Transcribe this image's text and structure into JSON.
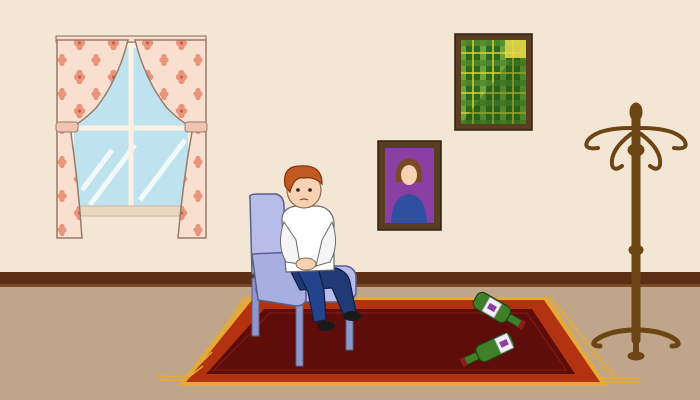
{
  "scene": {
    "type": "point-and-click room",
    "colors": {
      "wall": "#f3e6d4",
      "floor": "#bfa58a",
      "baseboard": "#5a2f14",
      "rug_outer": "#b3320f",
      "rug_inner": "#5e0d0a",
      "rug_fringe": "#e3a93a",
      "chair": "#b7bde8",
      "coat_rack": "#6b4513",
      "bottle_glass": "#3f7f27",
      "curtain": "#f8dfd0",
      "curtain_flower": "#e8957a",
      "window_glass": "#bfe3ee"
    },
    "objects": [
      {
        "name": "window",
        "icon": "window-icon"
      },
      {
        "name": "portrait-painting",
        "icon": "portrait-icon"
      },
      {
        "name": "abstract-painting",
        "icon": "plaid-painting-icon"
      },
      {
        "name": "coat-rack",
        "icon": "coat-rack-icon"
      },
      {
        "name": "chair",
        "icon": "chair-icon"
      },
      {
        "name": "boy",
        "icon": "boy-icon"
      },
      {
        "name": "rug",
        "icon": "rug-icon"
      },
      {
        "name": "wine-bottle",
        "icon": "bottle-icon",
        "count": 2
      }
    ]
  }
}
